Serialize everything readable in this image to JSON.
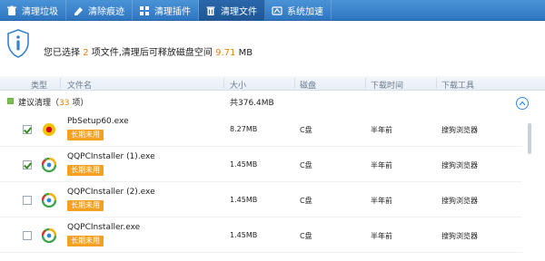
{
  "toolbar": {
    "tabs": [
      {
        "label": "清理垃圾",
        "icon": "trash-can-icon",
        "active": false
      },
      {
        "label": "清除痕迹",
        "icon": "eraser-icon",
        "active": false
      },
      {
        "label": "清理插件",
        "icon": "plugin-icon",
        "active": false
      },
      {
        "label": "清理文件",
        "icon": "file-trash-icon",
        "active": true
      },
      {
        "label": "系统加速",
        "icon": "speed-icon",
        "active": false
      }
    ]
  },
  "summary": {
    "prefix": "您已选择",
    "count": "2",
    "middle": "项文件,清理后可释放磁盘空间",
    "size": "9.71",
    "unit": "MB"
  },
  "columns": {
    "type": "类型",
    "name": "文件名",
    "size": "大小",
    "disk": "磁盘",
    "time": "下载时间",
    "tool": "下载工具"
  },
  "group": {
    "name_prefix": "建议清理（",
    "count": "33",
    "name_suffix": " 项）",
    "total": "共376.4MB"
  },
  "rows": [
    {
      "name": "PbSetup60.exe",
      "badge": "长期未用",
      "size": "8.27MB",
      "disk": "C盘",
      "time": "半年前",
      "tool": "搜狗浏览器",
      "checked": true,
      "icon": "pbsetup-app-icon"
    },
    {
      "name": "QQPCInstaller (1).exe",
      "badge": "长期未用",
      "size": "1.45MB",
      "disk": "C盘",
      "time": "半年前",
      "tool": "搜狗浏览器",
      "checked": true,
      "icon": "qqpc-installer-icon"
    },
    {
      "name": "QQPCInstaller (2).exe",
      "badge": "长期未用",
      "size": "1.45MB",
      "disk": "C盘",
      "time": "半年前",
      "tool": "搜狗浏览器",
      "checked": false,
      "icon": "qqpc-installer-icon"
    },
    {
      "name": "QQPCInstaller.exe",
      "badge": "长期未用",
      "size": "1.45MB",
      "disk": "C盘",
      "time": "半年前",
      "tool": "搜狗浏览器",
      "checked": false,
      "icon": "qqpc-installer-icon"
    }
  ],
  "colors": {
    "toolbar": "#3a82cc",
    "highlight": "#f07d00",
    "badge": "#f4a020",
    "group_check": "#7ac04f"
  }
}
